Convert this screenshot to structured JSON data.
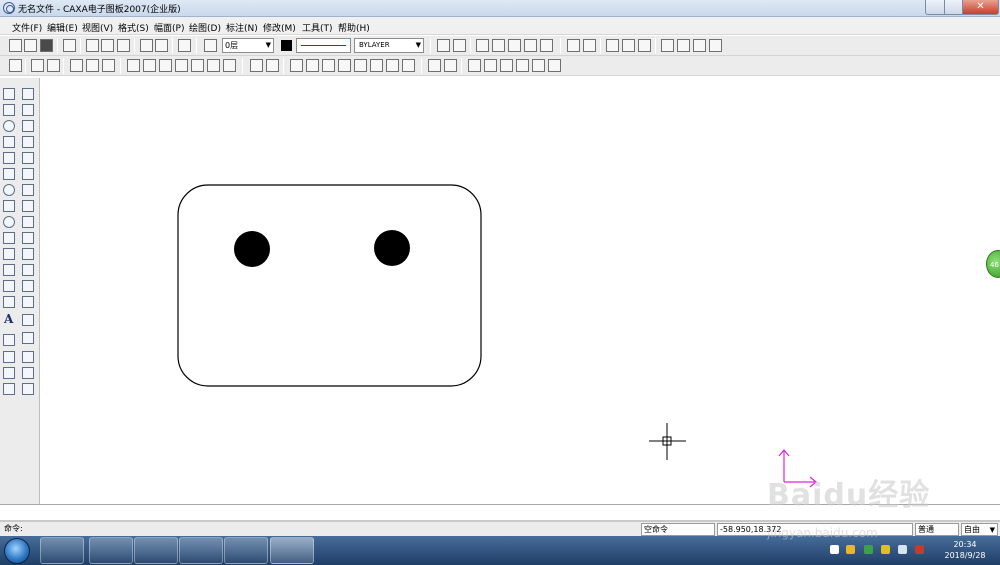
{
  "window": {
    "title": "无名文件 - CAXA电子图板2007(企业版)",
    "close_glyph": "✕"
  },
  "menu": [
    {
      "label": "文件(F)"
    },
    {
      "label": "编辑(E)"
    },
    {
      "label": "视图(V)"
    },
    {
      "label": "格式(S)"
    },
    {
      "label": "幅面(P)"
    },
    {
      "label": "绘图(D)"
    },
    {
      "label": "标注(N)"
    },
    {
      "label": "修改(M)"
    },
    {
      "label": "工具(T)"
    },
    {
      "label": "帮助(H)"
    }
  ],
  "properties": {
    "layer": "0层",
    "color": "BYLAYER",
    "linewidth": "BYLAYER",
    "dropdown_glyph": "▼"
  },
  "colors": {
    "canvas": "#ffffff",
    "ucs_axis": "#e020e0",
    "linetype_sample": "#dd0000",
    "title_gradient": "#c9d8ec"
  },
  "left_toolbar": {
    "text_tool_glyph": "A"
  },
  "status": {
    "prompt": "命令:",
    "command_state": "空命令",
    "coordinates": "-58.950,18.372",
    "mode": "普通",
    "snap": "自由"
  },
  "tray": {
    "time": "20:34",
    "date": "2018/9/28"
  },
  "green_badge": "46",
  "watermark": {
    "brand": "Baidu经验",
    "url": "jingyan.baidu.com"
  }
}
